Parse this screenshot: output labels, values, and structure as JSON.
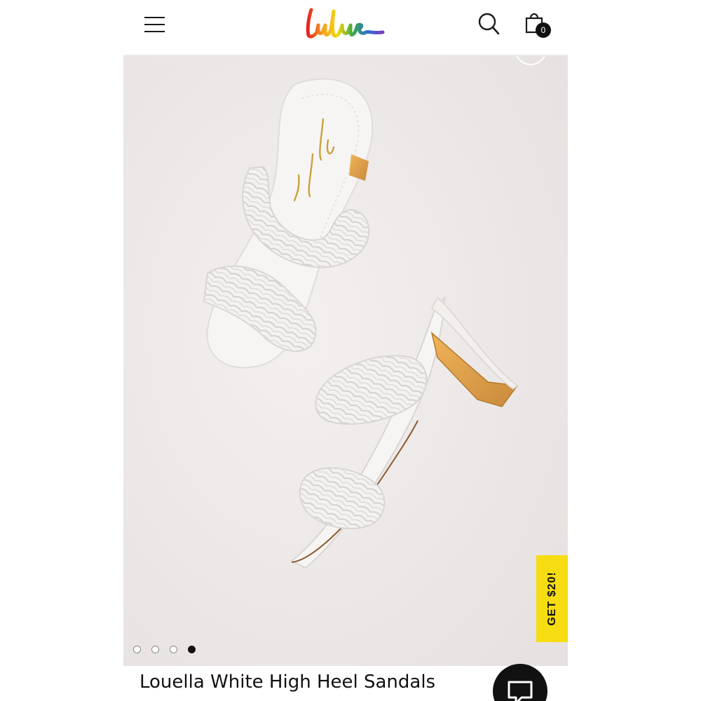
{
  "header": {
    "menu_icon": "hamburger-menu-icon",
    "logo_text": "Lulus",
    "search_icon": "search-icon",
    "cart_icon": "shopping-bag-icon",
    "cart_count": "0",
    "logo_colors": [
      "#e52421",
      "#f7a21b",
      "#f4d90f",
      "#3aa845",
      "#2a6fd6",
      "#7b3fb8"
    ]
  },
  "product": {
    "title": "Louella White High Heel Sandals",
    "image_icon": "product-photo",
    "carousel": {
      "total": 4,
      "active_index": 4
    }
  },
  "promo": {
    "label": "GET $20!",
    "color": "#f6dc12"
  },
  "chat": {
    "icon": "chat-bubble-icon"
  }
}
